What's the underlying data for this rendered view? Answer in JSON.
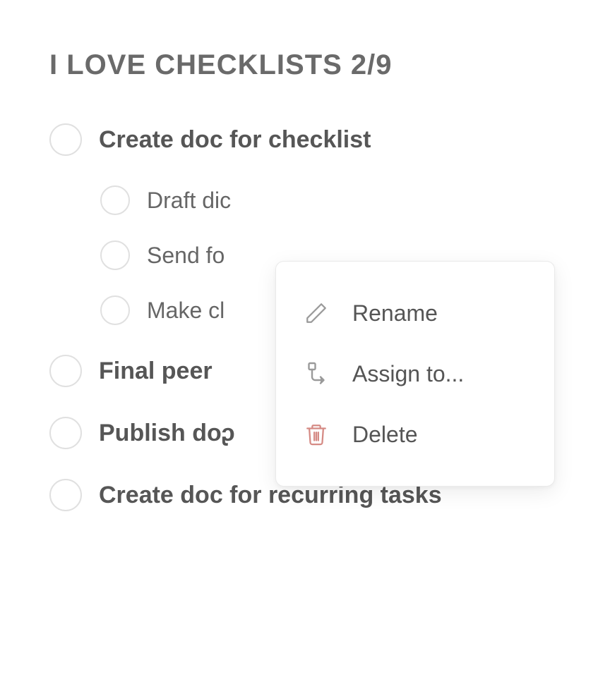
{
  "checklist": {
    "title": "I LOVE CHECKLISTS 2/9",
    "items": [
      {
        "label": "Create doc for checklist",
        "checked": false,
        "children": [
          {
            "label": "Draft dic",
            "checked": false
          },
          {
            "label": "Send fo",
            "checked": false
          },
          {
            "label": "Make cl",
            "checked": false
          }
        ]
      },
      {
        "label": "Final peer",
        "checked": false
      },
      {
        "label": "Publish doᶗ",
        "checked": false
      },
      {
        "label": "Create doc for recurring tasks",
        "checked": false
      }
    ]
  },
  "contextMenu": {
    "items": [
      {
        "icon": "pencil-icon",
        "label": "Rename"
      },
      {
        "icon": "assign-icon",
        "label": "Assign to..."
      },
      {
        "icon": "trash-icon",
        "label": "Delete"
      }
    ]
  },
  "colors": {
    "text": "#565656",
    "muted": "#6a6a6a",
    "border": "#e0e0e0",
    "danger": "#d58a84"
  }
}
